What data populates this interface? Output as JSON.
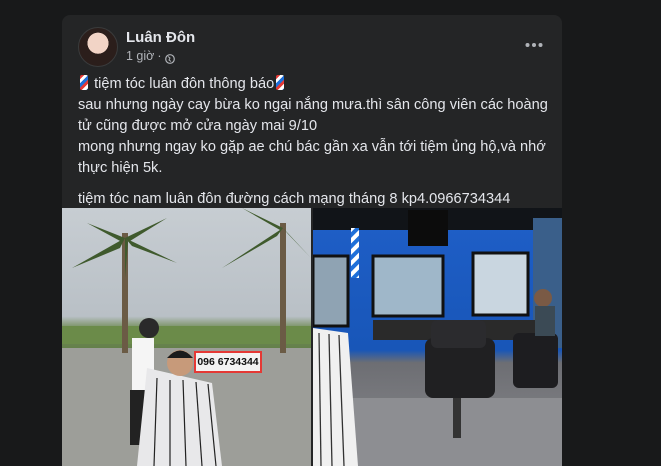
{
  "post": {
    "author": "Luân Đôn",
    "time": "1 giờ",
    "lines": {
      "line1": "tiệm tóc luân đôn thông báo",
      "line2": "sau nhưng ngày cay bừa ko ngại nắng mưa.thì sân công viên các hoàng tử cũng được mở cửa ngày mai 9/10",
      "line3": "mong nhưng ngay ko gặp ae chú bác gần xa vẫn tới tiệm ủng hộ,và nhớ thực hiện 5k.",
      "line4": "tiệm tóc nam luân đôn đường cách mạng tháng 8 kp4.0966734344"
    },
    "photo_phone_label": "096 6734344"
  },
  "icons": {
    "privacy": "globe-icon",
    "options": "more-horizontal-icon",
    "emoji": "barber-pole-icon"
  },
  "colors": {
    "background": "#18191a",
    "card": "#242526",
    "text": "#e4e6eb",
    "secondary_text": "#b0b3b8",
    "highlight_border": "#e53935"
  }
}
